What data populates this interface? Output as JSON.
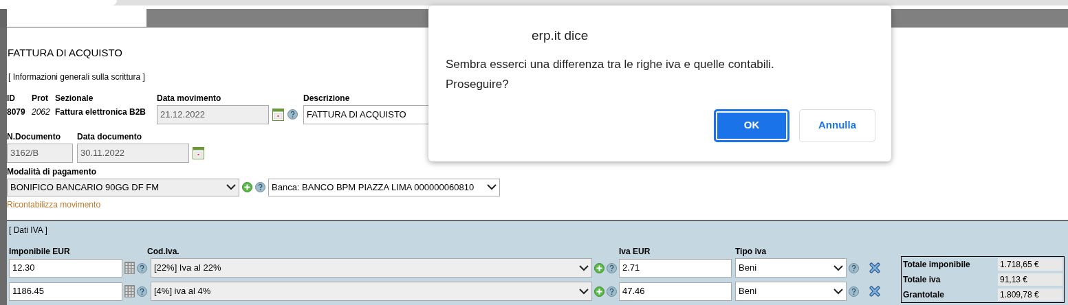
{
  "page_title": "FATTURA DI ACQUISTO",
  "general_section": "[ Informazioni generali sulla scrittura ]",
  "info": {
    "id_label": "ID",
    "id": "8079",
    "prot_label": "Prot",
    "prot": "2062",
    "sezionale_label": "Sezionale",
    "sezionale": "Fattura elettronica B2B",
    "data_movimento": {
      "label": "Data movimento",
      "value": "21.12.2022",
      "disabled": true
    },
    "descrizione": {
      "label": "Descrizione",
      "value": "FATTURA DI ACQUISTO",
      "disabled": false
    },
    "n_documento": {
      "label": "N.Documento",
      "value": "3162/B",
      "disabled": true
    },
    "data_documento": {
      "label": "Data documento",
      "value": "30.11.2022",
      "disabled": true
    },
    "pagamento": {
      "label": "Modalità di pagamento",
      "value": "BONIFICO BANCARIO 90GG DF FM"
    },
    "banca": {
      "value": "Banca: BANCO BPM PIAZZA LIMA 000000060810"
    },
    "link": "Ricontabilizza movimento"
  },
  "iva_section": {
    "title": "[ Dati IVA ]",
    "columns": [
      "Imponibile EUR",
      "Cod.Iva.",
      "Iva EUR",
      "Tipo iva"
    ],
    "rows": [
      {
        "imponibile": "12.30",
        "cod_iva": "[22%] Iva al 22%",
        "iva": "2.71",
        "tipo": "Beni"
      },
      {
        "imponibile": "1186.45",
        "cod_iva": "[4%] iva al 4%",
        "iva": "47.46",
        "tipo": "Beni"
      }
    ],
    "totals": [
      {
        "label": "Totale imponibile",
        "value": "1.718,65 €"
      },
      {
        "label": "Totale iva",
        "value": "91,13 €"
      },
      {
        "label": "Grantotale",
        "value": "1.809,78 €"
      }
    ]
  },
  "dialog": {
    "origin": "erp.it dice",
    "message": "Sembra esserci una differenza tra le righe iva e quelle contabili.",
    "question": "Proseguire?",
    "buttons": [
      {
        "label": "OK",
        "kind": "primary"
      },
      {
        "label": "Annulla",
        "kind": "secondary"
      }
    ]
  }
}
